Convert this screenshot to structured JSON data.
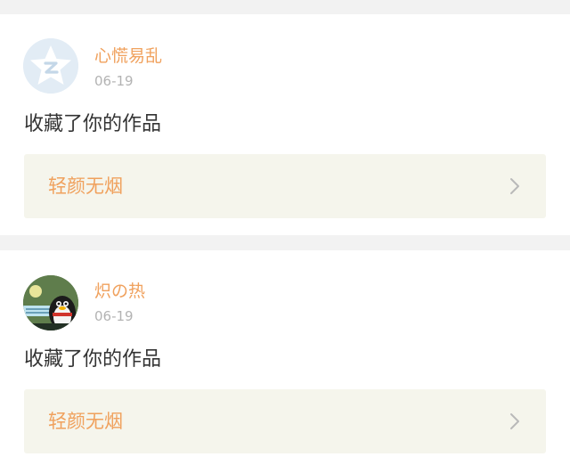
{
  "feed": {
    "items": [
      {
        "username": "心慌易乱",
        "date": "06-19",
        "action": "收藏了你的作品",
        "work_title": "轻颜无烟",
        "avatar_icon": "default-qzone-star-avatar"
      },
      {
        "username": "炽の热",
        "date": "06-19",
        "action": "收藏了你的作品",
        "work_title": "轻颜无烟",
        "avatar_icon": "penguin-photo-avatar"
      }
    ]
  },
  "colors": {
    "accent": "#f0a15d",
    "background": "#f2f2f2",
    "card": "#ffffff",
    "link_box": "#f5f5ec",
    "date_text": "#b3b3b3",
    "body_text": "#333333"
  }
}
